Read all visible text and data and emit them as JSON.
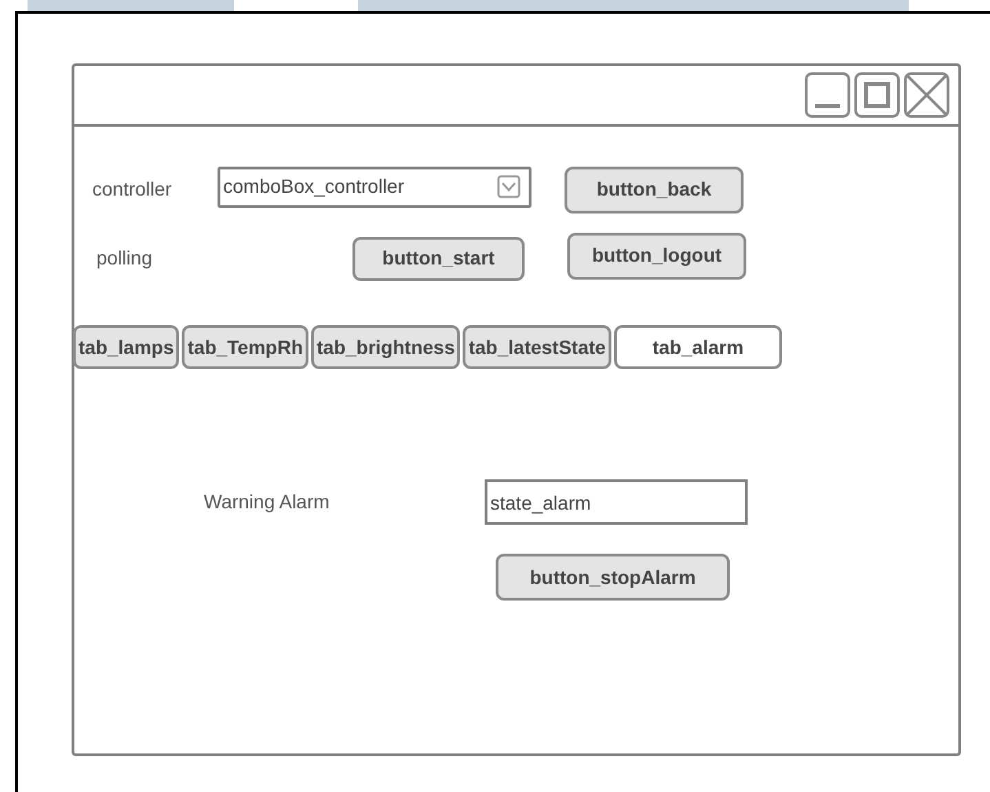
{
  "form": {
    "controller_label": "controller",
    "combo_value": "comboBox_controller",
    "polling_label": "polling"
  },
  "buttons": [
    {
      "kind": "back",
      "label": "button_back"
    },
    {
      "kind": "start",
      "label": "button_start"
    },
    {
      "kind": "logout",
      "label": "button_logout"
    }
  ],
  "tabs": [
    {
      "label": "tab_lamps",
      "selected": false
    },
    {
      "label": "tab_TempRh",
      "selected": false
    },
    {
      "label": "tab_brightness",
      "selected": false
    },
    {
      "label": "tab_latestState",
      "selected": false
    },
    {
      "label": "tab_alarm",
      "selected": true
    }
  ],
  "alarm_panel": {
    "label": "Warning Alarm",
    "state_value": "state_alarm",
    "stop_button": "button_stopAlarm"
  }
}
